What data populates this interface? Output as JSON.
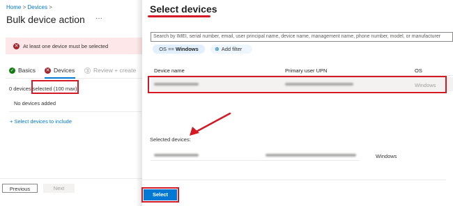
{
  "breadcrumb": {
    "home": "Home",
    "sep1": ">",
    "devices": "Devices",
    "sep2": ">"
  },
  "page": {
    "title": "Bulk device action",
    "more": "···"
  },
  "error": {
    "icon": "error-icon",
    "text": "At least one device must be selected"
  },
  "steps": [
    {
      "label": "Basics",
      "state": "done",
      "icon": "check-icon",
      "glyph": "✓"
    },
    {
      "label": "Devices",
      "state": "error",
      "icon": "x-icon",
      "glyph": "✕"
    },
    {
      "label": "Review + create",
      "state": "pending",
      "icon": "step-number-icon",
      "glyph": "3"
    }
  ],
  "selection": {
    "count_text": "0 devices selected",
    "max_text": "(100 max)",
    "empty": "No devices added",
    "link": "+ Select devices to include"
  },
  "footer": {
    "previous": "Previous",
    "next": "Next"
  },
  "panel": {
    "title": "Select devices",
    "search_placeholder": "Search by IMEI, serial number, email, user principal name, device name, management name, phone number, model, or manufacturer",
    "filter_pill_prefix": "OS == ",
    "filter_pill_value": "Windows",
    "add_filter": "Add filter",
    "columns": [
      "Device name",
      "Primary user UPN",
      "OS"
    ],
    "rows": [
      {
        "os": "Windows"
      }
    ],
    "selected_label": "Selected devices:",
    "selected_rows": [
      {
        "os": "Windows"
      }
    ],
    "select_button": "Select"
  },
  "colors": {
    "accent": "#0078d4",
    "annotation": "#d41924",
    "error_bg": "#fde7e9",
    "success": "#107c10"
  }
}
